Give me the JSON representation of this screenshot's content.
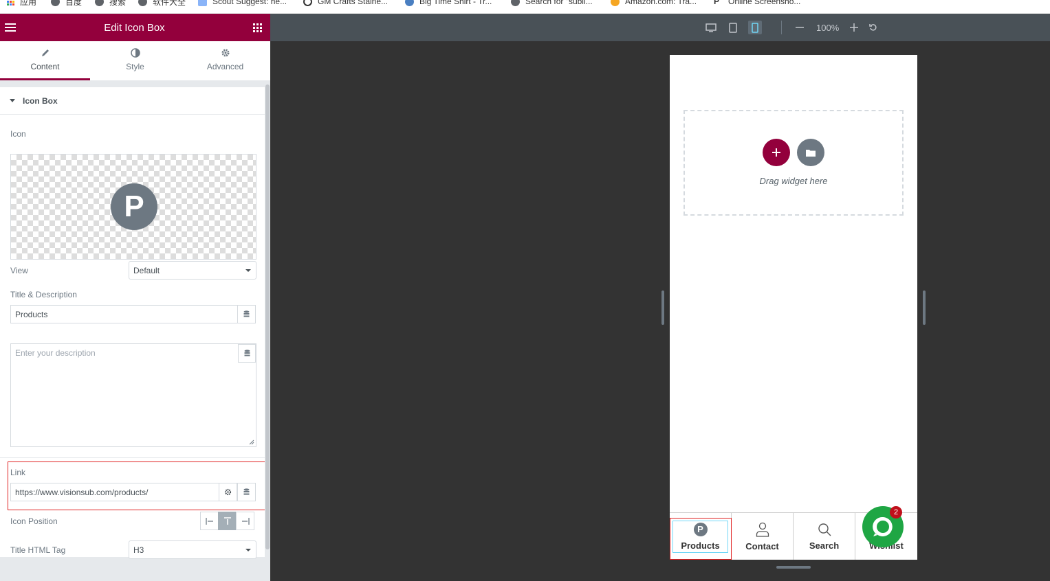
{
  "bookmarks": [
    {
      "label": "应用",
      "icon": "apps-icon"
    },
    {
      "label": "百度",
      "icon": "globe-icon"
    },
    {
      "label": "搜索",
      "icon": "globe-icon"
    },
    {
      "label": "软件大全",
      "icon": "globe-icon"
    },
    {
      "label": "Scout Suggest: he...",
      "icon": "scout-icon"
    },
    {
      "label": "GM Crafts Staine...",
      "icon": "clock-icon"
    },
    {
      "label": "Big Time Shirt - Tr...",
      "icon": "shirt-icon"
    },
    {
      "label": "Search for \"subli...",
      "icon": "globe-icon"
    },
    {
      "label": "Amazon.com: Tra...",
      "icon": "amazon-icon"
    },
    {
      "label": "Online Screensho...",
      "icon": "screenshot-icon"
    }
  ],
  "panel": {
    "title": "Edit Icon Box",
    "tabs": [
      {
        "label": "Content",
        "icon": "pencil-icon",
        "active": true
      },
      {
        "label": "Style",
        "icon": "contrast-icon",
        "active": false
      },
      {
        "label": "Advanced",
        "icon": "gear-icon",
        "active": false
      }
    ],
    "section_title": "Icon Box",
    "icon_label": "Icon",
    "icon_glyph": "P",
    "view_label": "View",
    "view_value": "Default",
    "title_desc_label": "Title & Description",
    "title_value": "Products",
    "description_placeholder": "Enter your description",
    "link_label": "Link",
    "link_value": "https://www.visionsub.com/products/",
    "icon_position_label": "Icon Position",
    "title_tag_label": "Title HTML Tag",
    "title_tag_value": "H3"
  },
  "preview": {
    "zoom": "100%",
    "dropzone_text": "Drag widget here",
    "nav": [
      {
        "label": "Products",
        "icon": "products-p-icon"
      },
      {
        "label": "Contact",
        "icon": "user-icon"
      },
      {
        "label": "Search",
        "icon": "search-icon"
      },
      {
        "label": "Wishlist",
        "icon": "heart-icon"
      }
    ],
    "chat_badge": "2"
  },
  "colors": {
    "accent": "#93003c",
    "panel_bg": "#e6e9ec",
    "chat_green": "#1fa644",
    "highlight_red": "#e02020"
  }
}
